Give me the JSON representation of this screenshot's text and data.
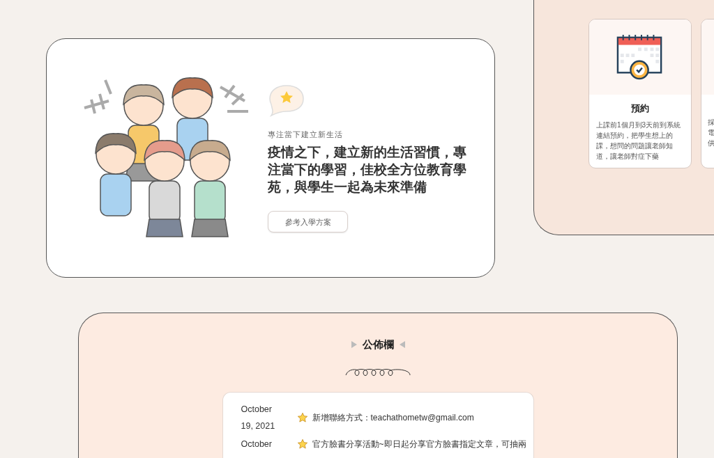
{
  "hero": {
    "subtitle": "專注當下建立新生活",
    "heading": "疫情之下，建立新的生活習慣，專注當下的學習，佳校全方位教育學苑，與學生一起為未來準備",
    "button": "參考入學方案"
  },
  "steps": [
    {
      "title": "預約",
      "text": "上課前1個月到3天前到系統連結預約，把學生想上的課，想問的問題讓老師知道，讓老師對症下藥"
    },
    {
      "lines": [
        "採",
        "電",
        "供"
      ]
    }
  ],
  "notices": {
    "title": "公佈欄",
    "items": [
      {
        "date": "October 19, 2021",
        "text": "新增聯絡方式：teachathometw@gmail.com"
      },
      {
        "date": "October",
        "text": "官方臉書分享活動~即日起分享官方臉書指定文章，可抽兩"
      }
    ]
  }
}
